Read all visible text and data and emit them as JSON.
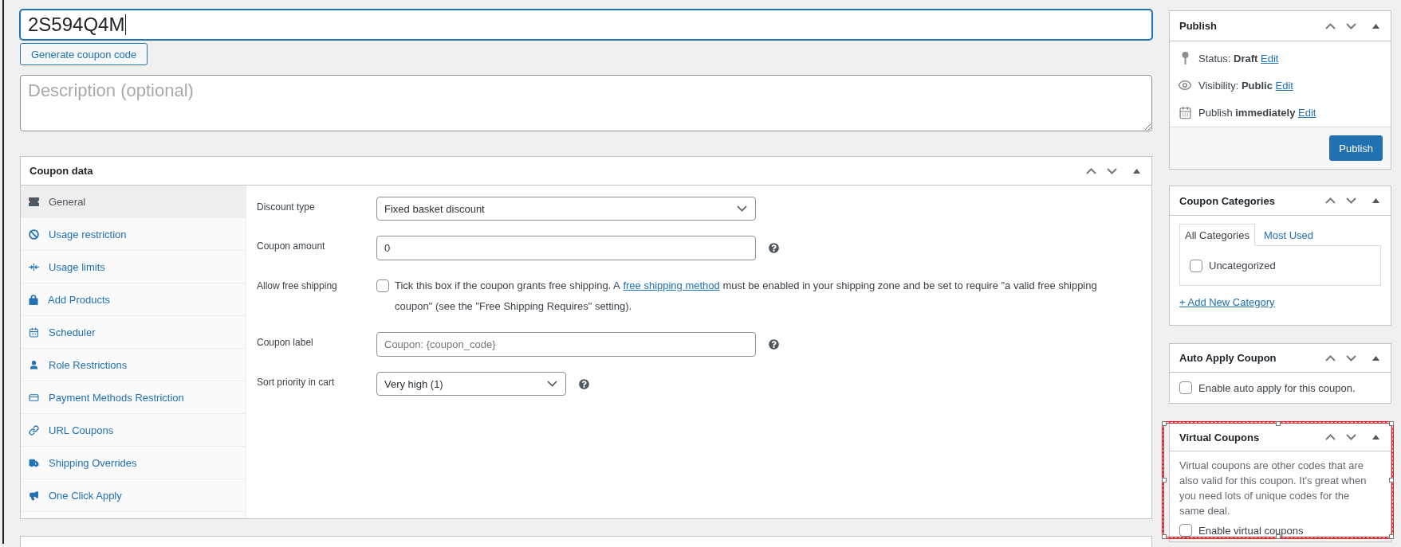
{
  "title_field": {
    "value": "2S594Q4M",
    "focused": true
  },
  "generate_button": {
    "label": "Generate coupon code"
  },
  "description_field": {
    "placeholder": "Description (optional)"
  },
  "coupon_data": {
    "title": "Coupon data",
    "tabs": [
      {
        "label": "General",
        "selected": true
      },
      {
        "label": "Usage restriction",
        "selected": false
      },
      {
        "label": "Usage limits",
        "selected": false
      },
      {
        "label": "Add Products",
        "selected": false
      },
      {
        "label": "Scheduler",
        "selected": false
      },
      {
        "label": "Role Restrictions",
        "selected": false
      },
      {
        "label": "Payment Methods Restriction",
        "selected": false
      },
      {
        "label": "URL Coupons",
        "selected": false
      },
      {
        "label": "Shipping Overrides",
        "selected": false
      },
      {
        "label": "One Click Apply",
        "selected": false
      }
    ],
    "fields": [
      {
        "kind": "select",
        "label": "Discount type",
        "value": "Fixed basket discount",
        "help": false
      },
      {
        "kind": "input",
        "label": "Coupon amount",
        "value": "0",
        "help": true
      },
      {
        "kind": "checkbox",
        "label": "Allow free shipping",
        "checked": false,
        "text": "Tick this box if the coupon grants free shipping. A",
        "link": "free shipping method",
        "text_after": "must be enabled in your shipping zone and be set to require \"a valid free shipping coupon\" (see the \"Free Shipping Requires\" setting).",
        "help": false
      },
      {
        "kind": "input",
        "label": "Coupon label",
        "placeholder": "Coupon: {coupon_code}",
        "help": true
      },
      {
        "kind": "compact-select",
        "label": "Sort priority in cart",
        "value": "Very high (1)",
        "help": true
      }
    ]
  },
  "publish": {
    "title": "Publish",
    "items": [
      {
        "text": "Status: **Draft**",
        "link": "Edit"
      },
      {
        "text": "Visibility: **Public**",
        "link": "Edit"
      },
      {
        "text": "Publish **immediately**",
        "link": "Edit"
      }
    ],
    "button": "Publish"
  },
  "coupon_categories": {
    "title": "Coupon Categories",
    "tabs": [
      {
        "label": "All Categories",
        "selected": true
      },
      {
        "label": "Most Used",
        "selected": false
      }
    ],
    "categories": [
      {
        "label": "Uncategorized",
        "checked": false
      }
    ],
    "add_link": "+ Add New Category"
  },
  "auto_apply": {
    "title": "Auto Apply Coupon",
    "option": {
      "label": "Enable auto apply for this coupon.",
      "checked": false
    }
  },
  "virtual_coupons": {
    "title": "Virtual Coupons",
    "highlighted": true,
    "description": "Virtual coupons are other codes that are also valid for this coupon. It's great when you need lots of unique codes for the same deal.",
    "option": {
      "label": "Enable virtual coupons",
      "checked": false
    }
  }
}
